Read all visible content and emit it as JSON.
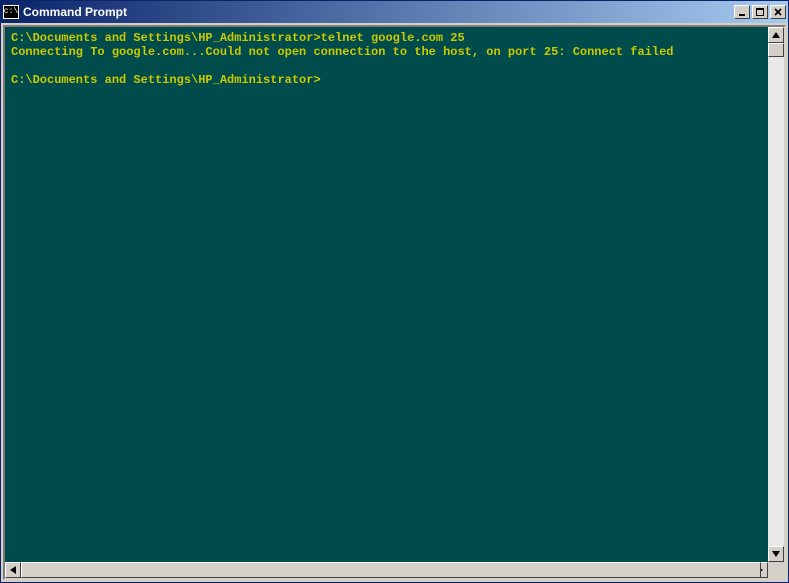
{
  "titlebar": {
    "icon_label": "c:\\",
    "title": "Command Prompt",
    "minimize": "_",
    "maximize": "□",
    "close": "×"
  },
  "terminal": {
    "lines": [
      {
        "type": "prompt",
        "prompt": "C:\\Documents and Settings\\HP_Administrator>",
        "command": "telnet google.com 25"
      },
      {
        "type": "output",
        "text": "Connecting To google.com...Could not open connection to the host, on port 25: Connect failed"
      },
      {
        "type": "blank",
        "text": ""
      },
      {
        "type": "prompt",
        "prompt": "C:\\Documents and Settings\\HP_Administrator>",
        "command": ""
      }
    ]
  },
  "colors": {
    "background": "#004b4b",
    "foreground": "#c9c900",
    "titlebar_start": "#0a246a",
    "titlebar_end": "#a6caf0"
  }
}
